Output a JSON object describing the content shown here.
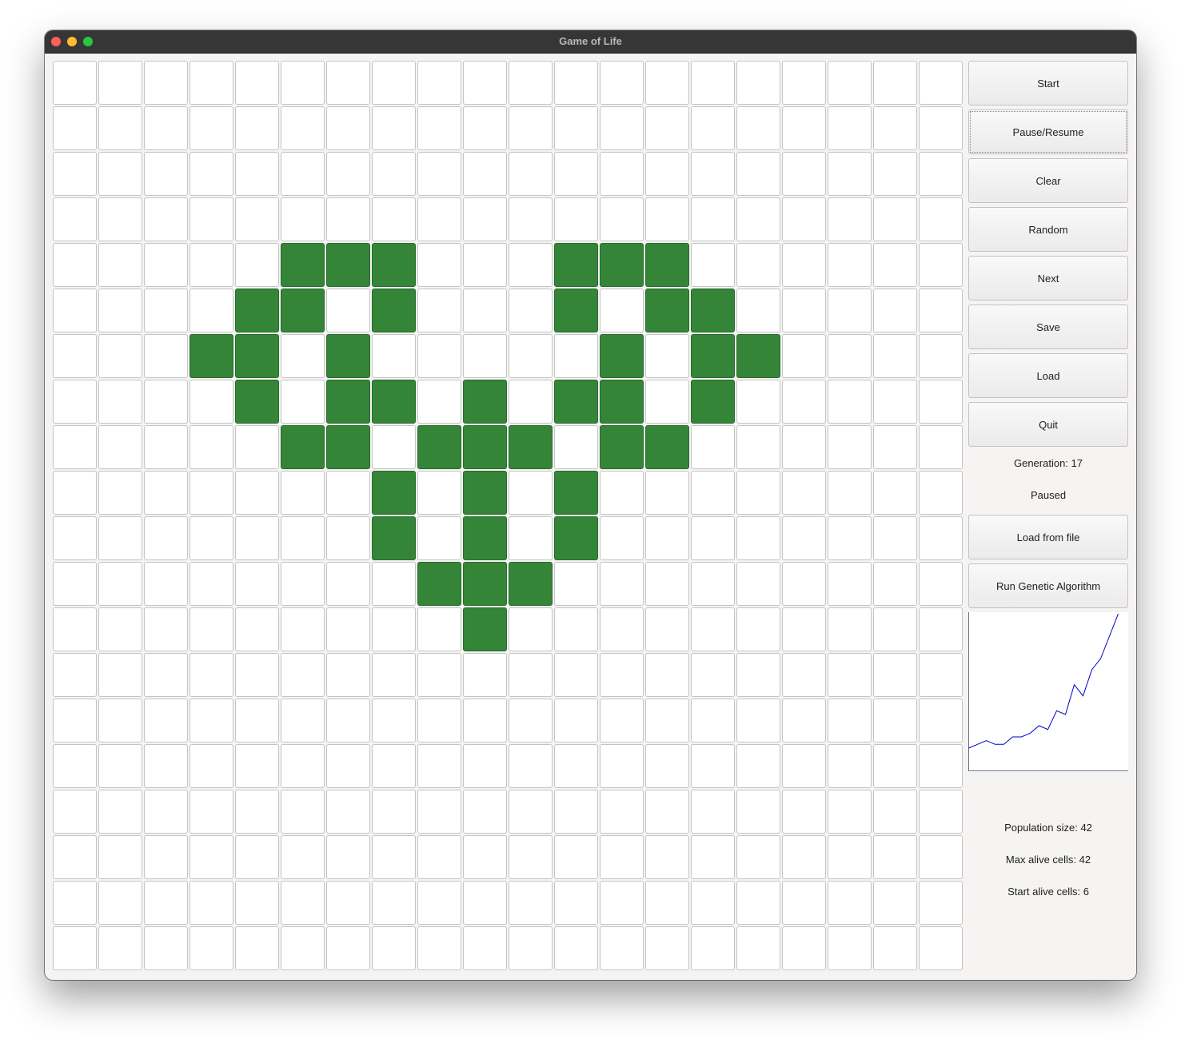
{
  "window": {
    "title": "Game of Life"
  },
  "grid": {
    "rows": 20,
    "cols": 20,
    "alive_color": "#348538",
    "dead_color": "#ffffff",
    "alive": [
      [
        4,
        5
      ],
      [
        4,
        6
      ],
      [
        4,
        7
      ],
      [
        4,
        11
      ],
      [
        4,
        12
      ],
      [
        4,
        13
      ],
      [
        5,
        4
      ],
      [
        5,
        5
      ],
      [
        5,
        7
      ],
      [
        5,
        11
      ],
      [
        5,
        13
      ],
      [
        5,
        14
      ],
      [
        6,
        3
      ],
      [
        6,
        4
      ],
      [
        6,
        6
      ],
      [
        6,
        12
      ],
      [
        6,
        14
      ],
      [
        6,
        15
      ],
      [
        7,
        4
      ],
      [
        7,
        6
      ],
      [
        7,
        7
      ],
      [
        7,
        9
      ],
      [
        7,
        11
      ],
      [
        7,
        12
      ],
      [
        7,
        14
      ],
      [
        8,
        5
      ],
      [
        8,
        6
      ],
      [
        8,
        8
      ],
      [
        8,
        9
      ],
      [
        8,
        10
      ],
      [
        8,
        12
      ],
      [
        8,
        13
      ],
      [
        9,
        7
      ],
      [
        9,
        9
      ],
      [
        9,
        11
      ],
      [
        10,
        7
      ],
      [
        10,
        9
      ],
      [
        10,
        11
      ],
      [
        11,
        8
      ],
      [
        11,
        9
      ],
      [
        11,
        10
      ],
      [
        12,
        9
      ]
    ]
  },
  "controls": {
    "start": "Start",
    "pause_resume": "Pause/Resume",
    "clear": "Clear",
    "random": "Random",
    "next": "Next",
    "save": "Save",
    "load": "Load",
    "quit": "Quit",
    "load_from_file": "Load from file",
    "run_genetic": "Run Genetic Algorithm"
  },
  "status": {
    "generation": "Generation: 17",
    "state": "Paused"
  },
  "stats": {
    "population_size": "Population size: 42",
    "max_alive_cells": "Max alive cells: 42",
    "start_alive_cells": "Start alive cells: 6"
  },
  "chart_data": {
    "type": "line",
    "title": "",
    "xlabel": "",
    "ylabel": "",
    "line_color": "#0000cc",
    "x": [
      0,
      1,
      2,
      3,
      4,
      5,
      6,
      7,
      8,
      9,
      10,
      11,
      12,
      13,
      14,
      15,
      16,
      17
    ],
    "values": [
      6,
      7,
      8,
      7,
      7,
      9,
      9,
      10,
      12,
      11,
      16,
      15,
      23,
      20,
      27,
      30,
      36,
      42
    ],
    "ylim": [
      0,
      42
    ]
  }
}
